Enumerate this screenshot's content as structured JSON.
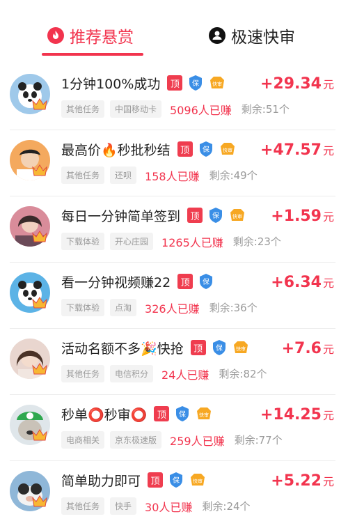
{
  "tabs": {
    "active": "推荐悬赏",
    "inactive": "极速快审"
  },
  "badges": {
    "top": "顶",
    "bao": "保",
    "fast": "快审"
  },
  "tasks": [
    {
      "title": "1分钟100%成功",
      "fast": true,
      "reward": "+29.34",
      "unit": "元",
      "tag1": "其他任务",
      "tag2": "中国移动卡",
      "earned": "5096人已赚",
      "remain": "剩余:51个"
    },
    {
      "title": "最高价🔥秒批秒结",
      "fast": true,
      "reward": "+47.57",
      "unit": "元",
      "tag1": "其他任务",
      "tag2": "还呗",
      "earned": "158人已赚",
      "remain": "剩余:49个"
    },
    {
      "title": "每日一分钟简单签到",
      "fast": true,
      "reward": "+1.59",
      "unit": "元",
      "tag1": "下载体验",
      "tag2": "开心庄园",
      "earned": "1265人已赚",
      "remain": "剩余:23个"
    },
    {
      "title": "看一分钟视频赚22",
      "fast": false,
      "reward": "+6.34",
      "unit": "元",
      "tag1": "下载体验",
      "tag2": "点淘",
      "earned": "326人已赚",
      "remain": "剩余:36个"
    },
    {
      "title": "活动名额不多🎉快抢",
      "fast": true,
      "reward": "+7.6",
      "unit": "元",
      "tag1": "其他任务",
      "tag2": "电信积分",
      "earned": "24人已赚",
      "remain": "剩余:82个"
    },
    {
      "title": "秒单⭕秒审⭕",
      "fast": true,
      "reward": "+14.25",
      "unit": "元",
      "tag1": "电商相关",
      "tag2": "京东极速版",
      "earned": "259人已赚",
      "remain": "剩余:77个"
    },
    {
      "title": "简单助力即可",
      "fast": true,
      "reward": "+5.22",
      "unit": "元",
      "tag1": "其他任务",
      "tag2": "快手",
      "earned": "30人已赚",
      "remain": "剩余:24个"
    }
  ],
  "colors": {
    "accent": "#f2344e",
    "muted": "#9a9a9a"
  }
}
